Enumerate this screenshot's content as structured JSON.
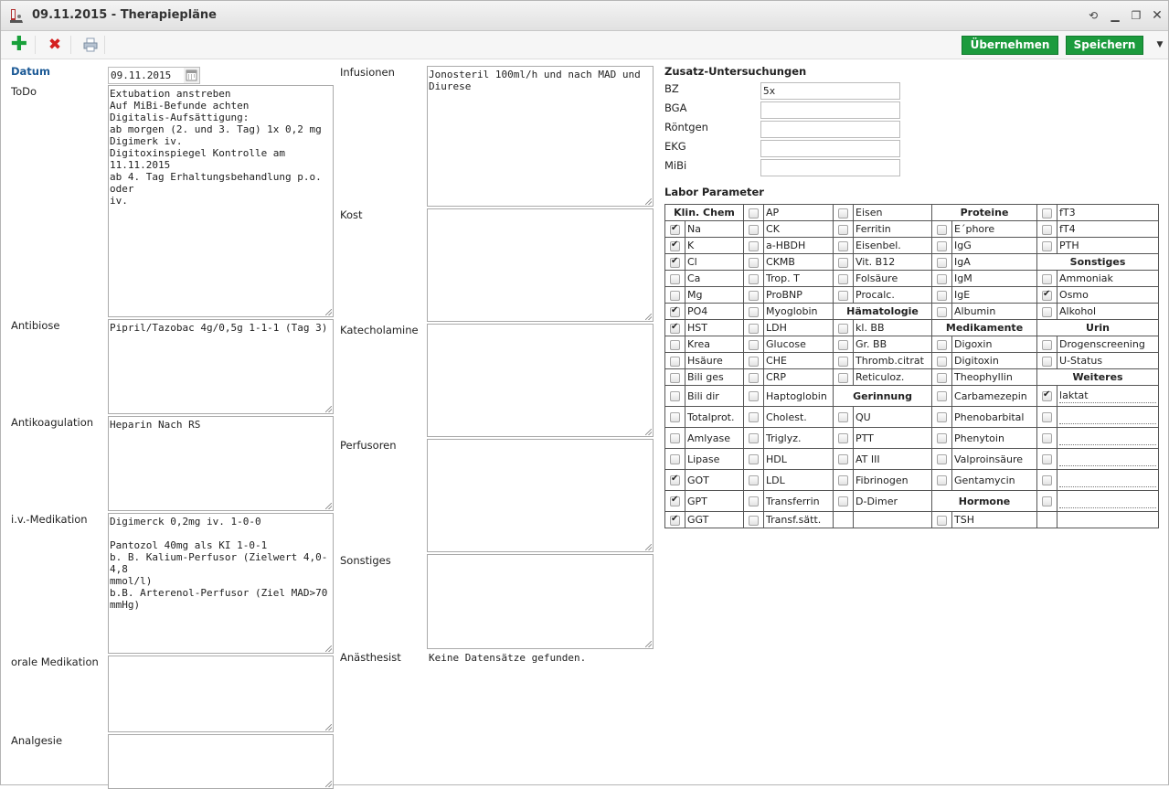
{
  "window": {
    "title": "09.11.2015 - Therapiepläne"
  },
  "icons": {
    "app": "patient-chart-icon",
    "add": "plus-icon",
    "delete": "x-icon",
    "print": "printer-icon",
    "refresh": "refresh-icon",
    "minimize": "minimize-icon",
    "restore": "restore-icon",
    "close": "close-icon",
    "calendar": "calendar-icon"
  },
  "colors": {
    "accent_green": "#1c9b3d",
    "label_blue": "#1c5a96",
    "add_green": "#18a03a",
    "delete_red": "#d42020"
  },
  "toolbar": {
    "apply_label": "Übernehmen",
    "save_label": "Speichern"
  },
  "left": {
    "datum": {
      "label": "Datum",
      "value": "09.11.2015"
    },
    "todo": {
      "label": "ToDo",
      "value": "Extubation anstreben\nAuf MiBi-Befunde achten\nDigitalis-Aufsättigung:\nab morgen (2. und 3. Tag) 1x 0,2 mg\nDigimerk iv.\nDigitoxinspiegel Kontrolle am 11.11.2015\nab 4. Tag Erhaltungsbehandlung p.o. oder\niv."
    },
    "antibiose": {
      "label": "Antibiose",
      "value": "Pipril/Tazobac 4g/0,5g 1-1-1 (Tag 3)"
    },
    "antikoagulation": {
      "label": "Antikoagulation",
      "value": "Heparin Nach RS"
    },
    "iv": {
      "label": "i.v.-Medikation",
      "value": "Digimerck 0,2mg iv. 1-0-0\n\nPantozol 40mg als KI 1-0-1\nb. B. Kalium-Perfusor (Zielwert 4,0-4,8\nmmol/l)\nb.B. Arterenol-Perfusor (Ziel MAD>70\nmmHg)"
    },
    "oral": {
      "label": "orale Medikation",
      "value": ""
    },
    "analgesie": {
      "label": "Analgesie",
      "value": ""
    }
  },
  "middle": {
    "infusionen": {
      "label": "Infusionen",
      "value": "Jonosteril 100ml/h und nach MAD und\nDiurese"
    },
    "kost": {
      "label": "Kost",
      "value": ""
    },
    "katecholamine": {
      "label": "Katecholamine",
      "value": ""
    },
    "perfusoren": {
      "label": "Perfusoren",
      "value": ""
    },
    "sonstiges": {
      "label": "Sonstiges",
      "value": ""
    },
    "anaesthesist": {
      "label": "Anästhesist",
      "value": "Keine Datensätze gefunden."
    }
  },
  "zusatz": {
    "title": "Zusatz-Untersuchungen",
    "rows": [
      {
        "label": "BZ",
        "value": "5x"
      },
      {
        "label": "BGA",
        "value": ""
      },
      {
        "label": "Röntgen",
        "value": ""
      },
      {
        "label": "EKG",
        "value": ""
      },
      {
        "label": "MiBi",
        "value": ""
      }
    ]
  },
  "labor": {
    "title": "Labor Parameter",
    "rows": [
      [
        {
          "h": "Klin. Chem"
        },
        {
          "t": "AP",
          "c": false
        },
        {
          "t": "Eisen",
          "c": false
        },
        {
          "h": "Proteine"
        },
        {
          "t": "fT3",
          "c": false
        }
      ],
      [
        {
          "t": "Na",
          "c": true
        },
        {
          "t": "CK",
          "c": false
        },
        {
          "t": "Ferritin",
          "c": false
        },
        {
          "t": "E´phore",
          "c": false
        },
        {
          "t": "fT4",
          "c": false
        }
      ],
      [
        {
          "t": "K",
          "c": true
        },
        {
          "t": "a-HBDH",
          "c": false
        },
        {
          "t": "Eisenbel.",
          "c": false
        },
        {
          "t": "IgG",
          "c": false
        },
        {
          "t": "PTH",
          "c": false
        }
      ],
      [
        {
          "t": "Cl",
          "c": true
        },
        {
          "t": "CKMB",
          "c": false
        },
        {
          "t": "Vit. B12",
          "c": false
        },
        {
          "t": "IgA",
          "c": false
        },
        {
          "h": "Sonstiges"
        }
      ],
      [
        {
          "t": "Ca",
          "c": false
        },
        {
          "t": "Trop. T",
          "c": false
        },
        {
          "t": "Folsäure",
          "c": false
        },
        {
          "t": "IgM",
          "c": false
        },
        {
          "t": "Ammoniak",
          "c": false
        }
      ],
      [
        {
          "t": "Mg",
          "c": false
        },
        {
          "t": "ProBNP",
          "c": false
        },
        {
          "t": "Procalc.",
          "c": false
        },
        {
          "t": "IgE",
          "c": false
        },
        {
          "t": "Osmo",
          "c": true
        }
      ],
      [
        {
          "t": "PO4",
          "c": true
        },
        {
          "t": "Myoglobin",
          "c": false
        },
        {
          "h": "Hämatologie"
        },
        {
          "t": "Albumin",
          "c": false
        },
        {
          "t": "Alkohol",
          "c": false
        }
      ],
      [
        {
          "t": "HST",
          "c": true
        },
        {
          "t": "LDH",
          "c": false
        },
        {
          "t": "kl. BB",
          "c": false
        },
        {
          "h": "Medikamente"
        },
        {
          "h": "Urin"
        }
      ],
      [
        {
          "t": "Krea",
          "c": false
        },
        {
          "t": "Glucose",
          "c": false
        },
        {
          "t": "Gr. BB",
          "c": false
        },
        {
          "t": "Digoxin",
          "c": false
        },
        {
          "t": "Drogenscreening",
          "c": false
        }
      ],
      [
        {
          "t": "Hsäure",
          "c": false
        },
        {
          "t": "CHE",
          "c": false
        },
        {
          "t": "Thromb.citrat",
          "c": false
        },
        {
          "t": "Digitoxin",
          "c": false
        },
        {
          "t": "U-Status",
          "c": false
        }
      ],
      [
        {
          "t": "Bili ges",
          "c": false
        },
        {
          "t": "CRP",
          "c": false
        },
        {
          "t": "Reticuloz.",
          "c": false
        },
        {
          "t": "Theophyllin",
          "c": false
        },
        {
          "h": "Weiteres"
        }
      ],
      [
        {
          "t": "Bili dir",
          "c": false
        },
        {
          "t": "Haptoglobin",
          "c": false
        },
        {
          "h": "Gerinnung"
        },
        {
          "t": "Carbamezepin",
          "c": false
        },
        {
          "t": "laktat",
          "c": true,
          "w": true
        }
      ],
      [
        {
          "t": "Totalprot.",
          "c": false
        },
        {
          "t": "Cholest.",
          "c": false
        },
        {
          "t": "QU",
          "c": false
        },
        {
          "t": "Phenobarbital",
          "c": false
        },
        {
          "t": "",
          "c": false,
          "w": true
        }
      ],
      [
        {
          "t": "Amlyase",
          "c": false
        },
        {
          "t": "Triglyz.",
          "c": false
        },
        {
          "t": "PTT",
          "c": false
        },
        {
          "t": "Phenytoin",
          "c": false
        },
        {
          "t": "",
          "c": false,
          "w": true
        }
      ],
      [
        {
          "t": "Lipase",
          "c": false
        },
        {
          "t": "HDL",
          "c": false
        },
        {
          "t": "AT III",
          "c": false
        },
        {
          "t": "Valproinsäure",
          "c": false
        },
        {
          "t": "",
          "c": false,
          "w": true
        }
      ],
      [
        {
          "t": "GOT",
          "c": true
        },
        {
          "t": "LDL",
          "c": false
        },
        {
          "t": "Fibrinogen",
          "c": false
        },
        {
          "t": "Gentamycin",
          "c": false
        },
        {
          "t": "",
          "c": false,
          "w": true
        }
      ],
      [
        {
          "t": "GPT",
          "c": true
        },
        {
          "t": "Transferrin",
          "c": false
        },
        {
          "t": "D-Dimer",
          "c": false
        },
        {
          "h": "Hormone"
        },
        {
          "t": "",
          "c": false,
          "w": true
        }
      ],
      [
        {
          "t": "GGT",
          "c": true
        },
        {
          "t": "Transf.sätt.",
          "c": false
        },
        {
          "e": true
        },
        {
          "t": "TSH",
          "c": false
        },
        {
          "e": true
        }
      ]
    ]
  }
}
